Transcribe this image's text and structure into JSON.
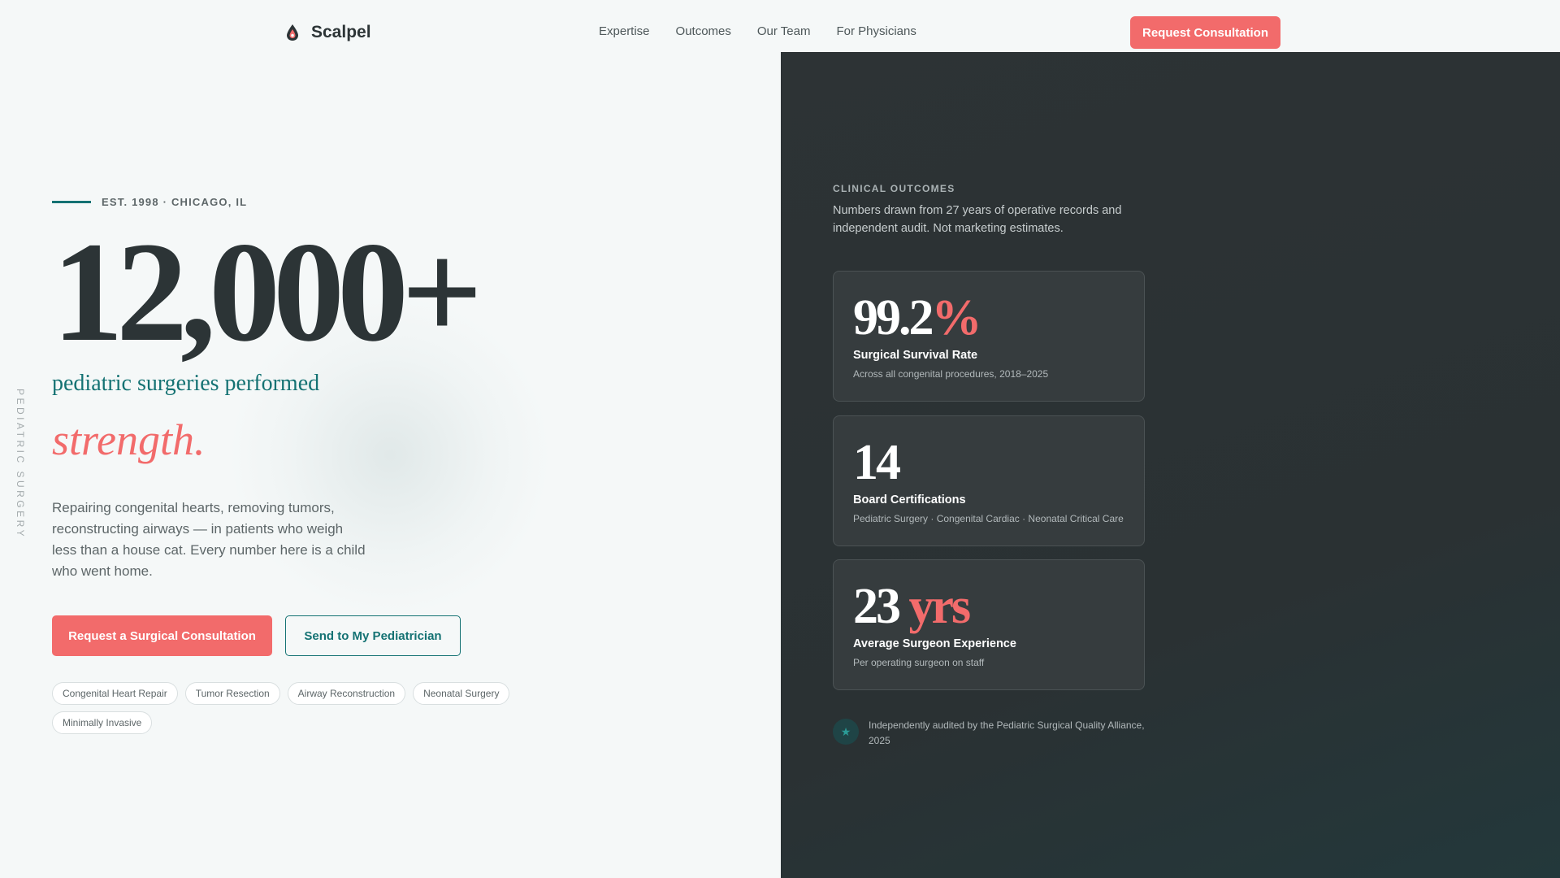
{
  "brand": {
    "name": "Scalpel",
    "logo_icon": "scalpel-drop-icon"
  },
  "nav": {
    "links": [
      "Expertise",
      "Outcomes",
      "Our Team",
      "For Physicians"
    ],
    "cta_label": "Request Consultation"
  },
  "side_label": "PEDIATRIC SURGERY",
  "hero": {
    "eyebrow": "EST. 1998 · CHICAGO, IL",
    "number": "12,000+",
    "subtitle": "pediatric surgeries performed",
    "accent_word": "strength.",
    "description": "Repairing congenital hearts, removing tumors, reconstructing airways — in patients who weigh less than a house cat. Every number here is a child who went home.",
    "primary_button": "Request a Surgical Consultation",
    "secondary_button": "Send to My Pediatrician",
    "tags": [
      "Congenital Heart Repair",
      "Tumor Resection",
      "Airway Reconstruction",
      "Neonatal Surgery",
      "Minimally Invasive"
    ]
  },
  "outcomes": {
    "eyebrow": "CLINICAL OUTCOMES",
    "intro": "Numbers drawn from 27 years of operative records and independent audit. Not marketing estimates.",
    "stats": [
      {
        "value": "99.2",
        "unit": "%",
        "label": "Surgical Survival Rate",
        "note": "Across all congenital procedures, 2018–2025"
      },
      {
        "value": "14",
        "unit": "",
        "label": "Board Certifications",
        "note": "Pediatric Surgery · Congenital Cardiac · Neonatal Critical Care"
      },
      {
        "value": "23",
        "unit": " yrs",
        "label": "Average Surgeon Experience",
        "note": "Per operating surgeon on staff"
      }
    ],
    "audit_icon": "star-badge-icon",
    "audit_text": "Independently audited by the Pediatric Surgical Quality Alliance, 2025"
  },
  "colors": {
    "accent_coral": "#f26b6b",
    "accent_teal": "#147273",
    "dark_panel": "#2d3335",
    "background": "#f5f8f8"
  }
}
